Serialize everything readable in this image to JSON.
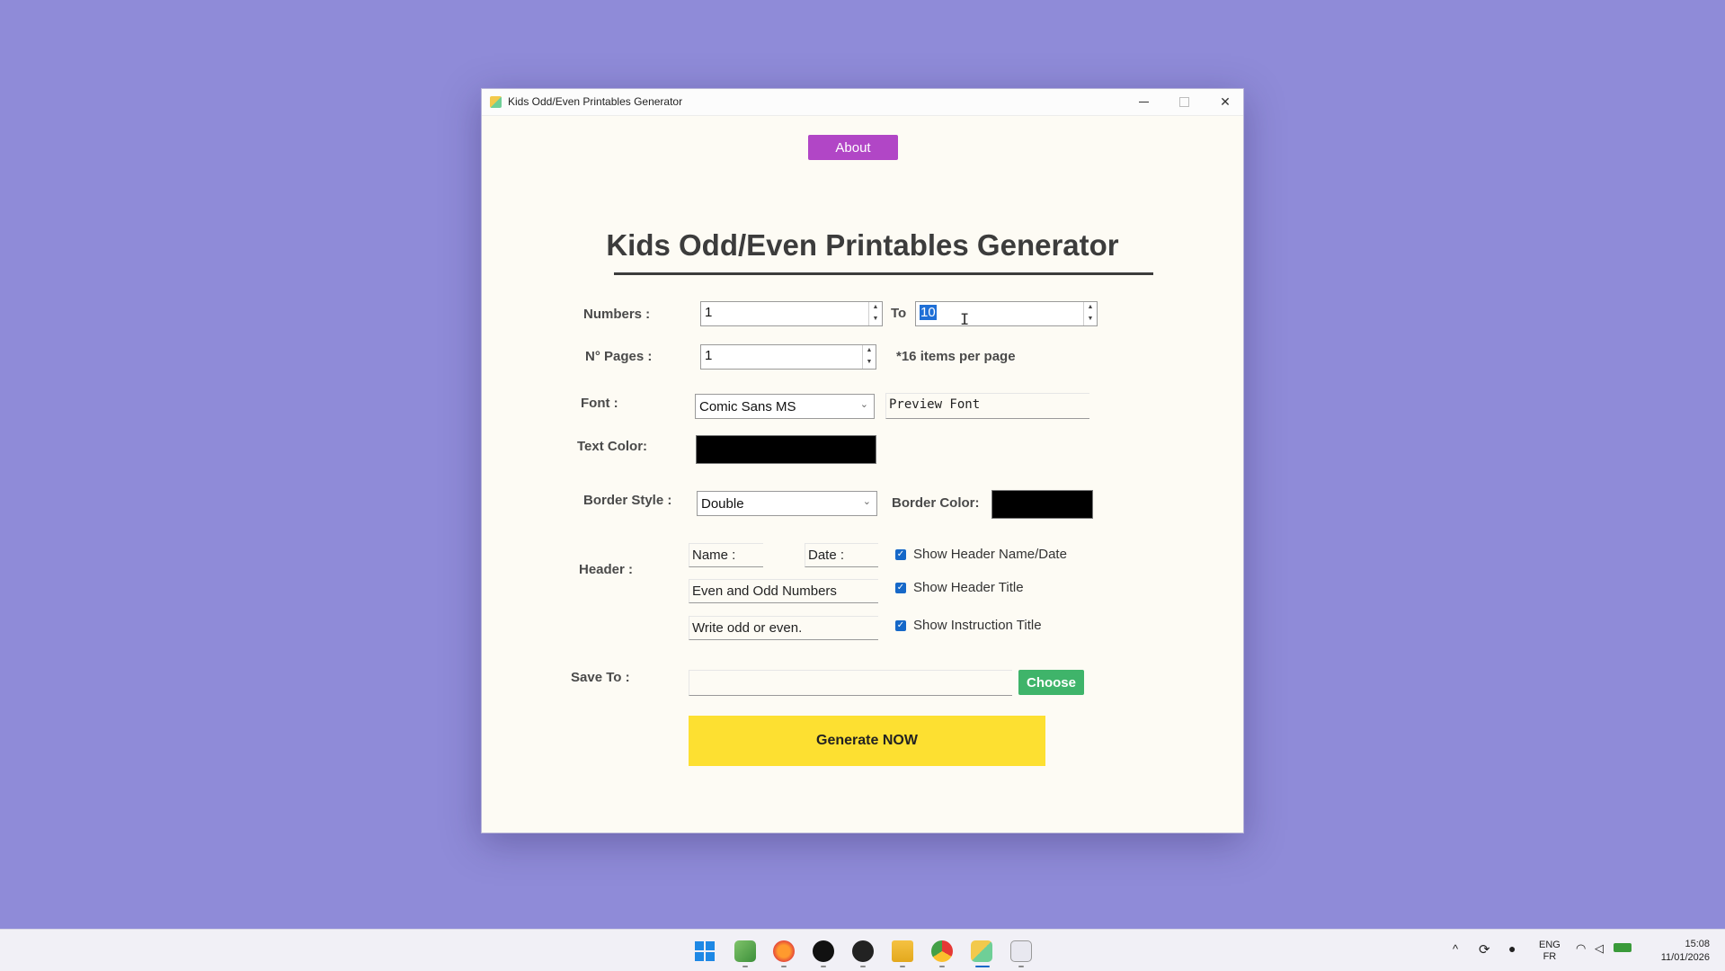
{
  "window": {
    "title": "Kids Odd/Even Printables Generator",
    "min_glyph": "",
    "close_glyph": "✕"
  },
  "about_label": "About",
  "main_title": "Kids Odd/Even Printables Generator",
  "numbers": {
    "label": "Numbers :",
    "from_value": "1",
    "to_label": "To",
    "to_value": "10"
  },
  "pages": {
    "label": "N° Pages :",
    "value": "1",
    "note": "*16 items per page"
  },
  "font": {
    "label": "Font :",
    "selected": "Comic Sans MS",
    "preview": "Preview Font"
  },
  "text_color": {
    "label": "Text Color:",
    "color": "#000000"
  },
  "border": {
    "style_label": "Border Style :",
    "selected": "Double",
    "color_label": "Border Color:",
    "color": "#000000"
  },
  "header": {
    "label": "Header :",
    "name_field": "Name :",
    "date_field": "Date :",
    "title_field": "Even and Odd Numbers",
    "instruction_field": "Write odd or even.",
    "show_name_date": "Show Header Name/Date",
    "show_title": "Show Header Title",
    "show_instruction": "Show Instruction Title"
  },
  "save": {
    "label": "Save To :",
    "path": "",
    "choose_label": "Choose"
  },
  "generate_label": "Generate NOW",
  "icons": {
    "spin_up": "▲",
    "spin_down": "▼",
    "dropdown": "⌄",
    "check": "✓",
    "text_cursor": "I"
  },
  "colors": {
    "background": "#8f8bd8",
    "about": "#b146c6",
    "choose": "#3fb46a",
    "generate": "#fde031"
  },
  "taskbar": {
    "lang_top": "ENG",
    "lang_bottom": "FR",
    "time": "15:08",
    "date": "11/01/2026"
  }
}
